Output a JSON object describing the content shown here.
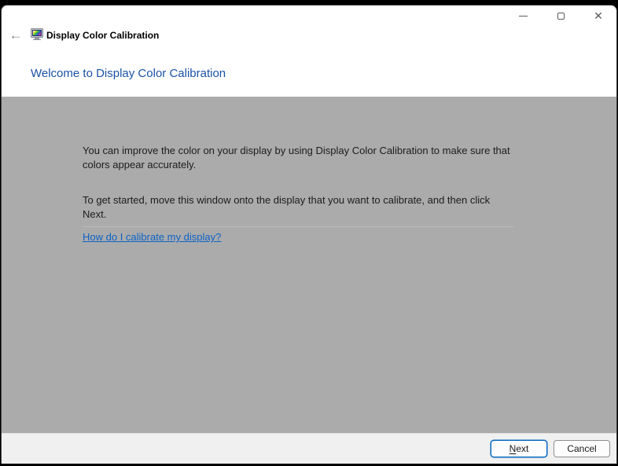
{
  "window": {
    "controls": {
      "minimize_icon": "minimize-icon",
      "maximize_icon": "maximize-icon",
      "close_icon": "✕"
    }
  },
  "header": {
    "back_icon": "←",
    "app_icon": "display-color-calibration-monitor-icon",
    "app_title": "Display Color Calibration",
    "heading": "Welcome to Display Color Calibration"
  },
  "main": {
    "paragraph1_lines": [
      "You can improve the color on your display by using Display Color Calibration to make sure that",
      "colors appear accurately."
    ],
    "paragraph2_lines": [
      "To get started, move this window onto the display that you want to calibrate, and then click",
      "Next."
    ],
    "help_link": "How do I calibrate my display?"
  },
  "footer": {
    "next_accesskey": "N",
    "next_rest": "ext",
    "cancel_label": "Cancel"
  },
  "colors": {
    "heading_blue": "#1b52a6",
    "link_blue": "#0d63c5",
    "content_bg": "#ababab",
    "footer_bg": "#f0f0f0",
    "next_border_blue": "#0467c0",
    "top_strip_black": "#000000"
  }
}
